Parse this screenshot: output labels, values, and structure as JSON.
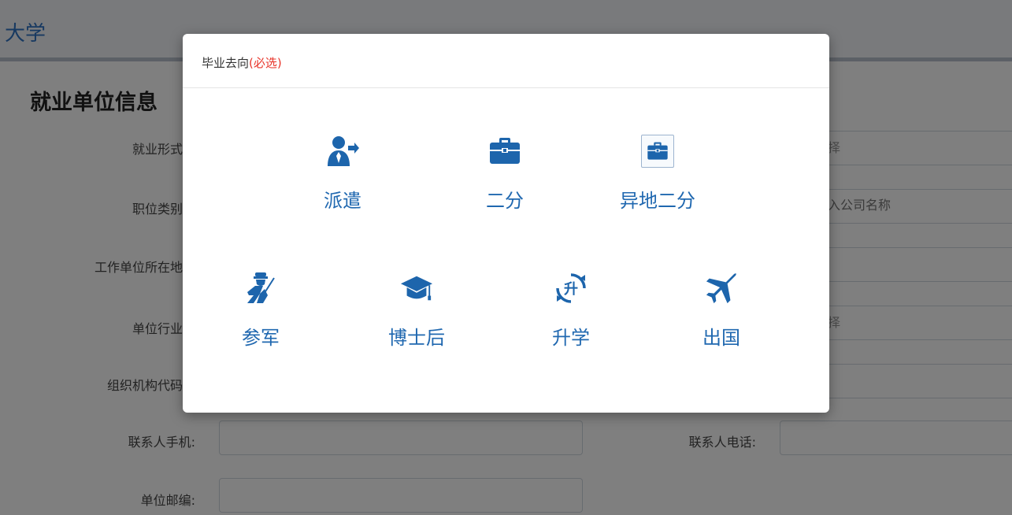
{
  "header": {
    "brand": "大学"
  },
  "section": {
    "title": "就业单位信息"
  },
  "form": {
    "employment_form": {
      "label": "就业形式",
      "value": "择"
    },
    "position_type": {
      "label": "职位类别",
      "placeholder": "入公司名称"
    },
    "work_location": {
      "label": "工作单位所在地",
      "value": ""
    },
    "industry": {
      "label": "单位行业",
      "value": "择"
    },
    "org_code": {
      "label": "组织机构代码",
      "value": ""
    },
    "contact_mobile": {
      "label": "联系人手机:",
      "value": ""
    },
    "contact_phone": {
      "label": "联系人电话:",
      "value": ""
    },
    "postcode": {
      "label": "单位邮编:",
      "value": ""
    }
  },
  "modal": {
    "title": "毕业去向",
    "required_tag": "(必选)",
    "options": [
      {
        "label": "派遣",
        "icon": "user-dispatch-icon"
      },
      {
        "label": "二分",
        "icon": "briefcase-icon"
      },
      {
        "label": "异地二分",
        "icon": "briefcase-icon",
        "selected": true
      },
      {
        "label": "参军",
        "icon": "soldier-icon"
      },
      {
        "label": "博士后",
        "icon": "graduation-cap-icon"
      },
      {
        "label": "升学",
        "icon": "upgrade-cycle-icon"
      },
      {
        "label": "出国",
        "icon": "airplane-icon"
      }
    ]
  },
  "colors": {
    "accent": "#2068b0",
    "required": "#e8362b",
    "brand": "#2f73c2"
  }
}
